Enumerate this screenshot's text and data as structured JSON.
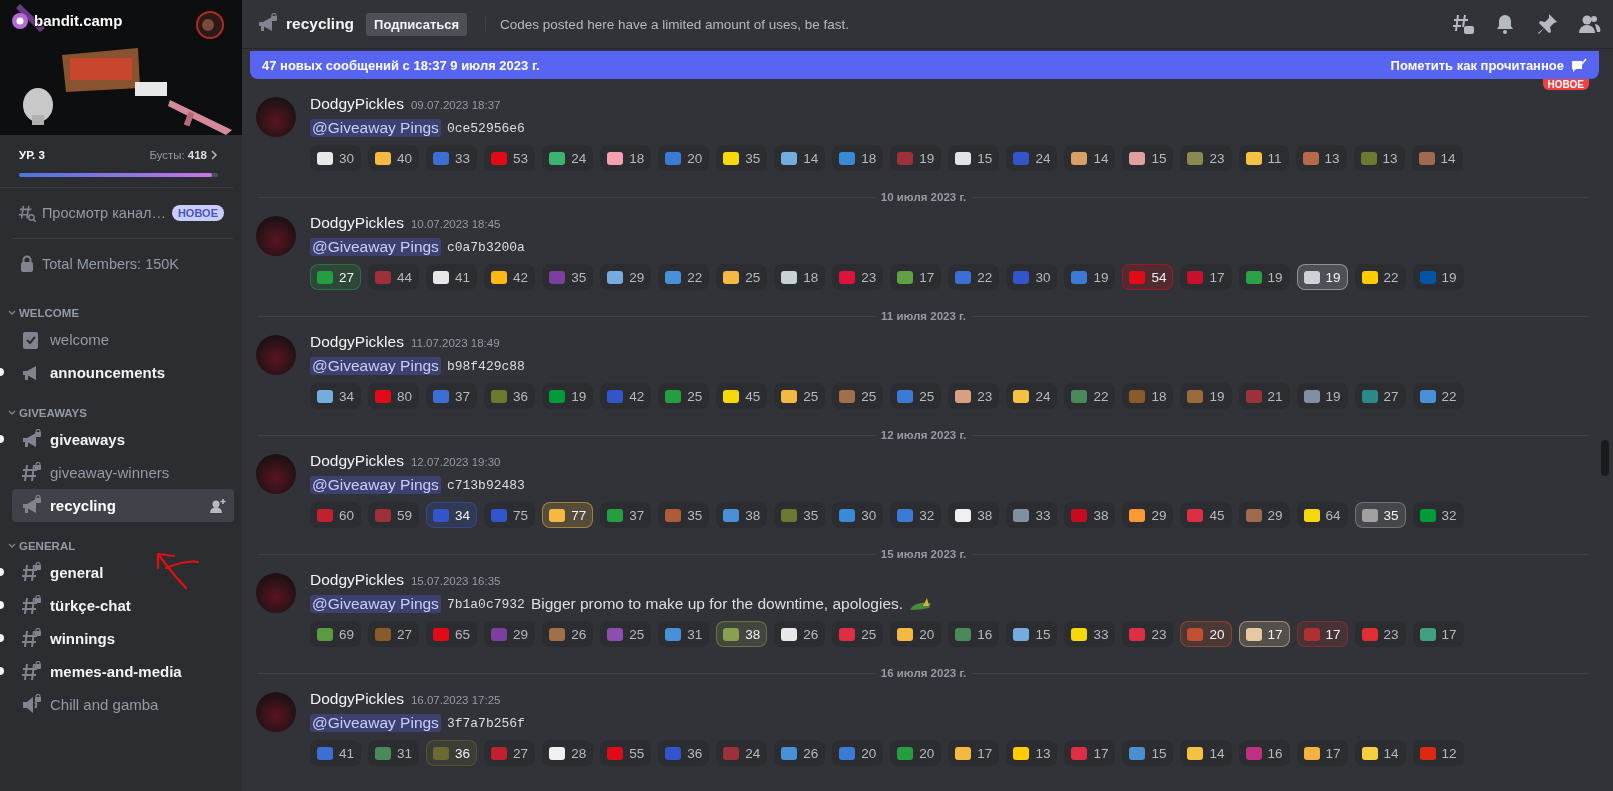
{
  "server": {
    "name": "bandit.camp"
  },
  "boost": {
    "level_label": "УР. 3",
    "boosts_label": "Бусты:",
    "boosts_count": "418",
    "level": 0.97
  },
  "browse": {
    "label": "Просмотр канал…",
    "badge": "НОВОЕ"
  },
  "members": {
    "label": "Total Members: 150K"
  },
  "categories": [
    {
      "name": "WELCOME",
      "expanded": true,
      "channels": [
        {
          "name": "welcome",
          "kind": "rules",
          "unread": false,
          "selected": false
        },
        {
          "name": "announcements",
          "kind": "announcement",
          "unread": true,
          "selected": false
        }
      ]
    },
    {
      "name": "GIVEAWAYS",
      "expanded": true,
      "channels": [
        {
          "name": "giveaways",
          "kind": "announcement-locked",
          "unread": true,
          "selected": false
        },
        {
          "name": "giveaway-winners",
          "kind": "text-locked",
          "unread": false,
          "selected": false
        },
        {
          "name": "recycling",
          "kind": "announcement-locked",
          "unread": false,
          "selected": true
        }
      ]
    },
    {
      "name": "GENERAL",
      "expanded": true,
      "channels": [
        {
          "name": "general",
          "kind": "text-locked",
          "unread": true,
          "selected": false
        },
        {
          "name": "türkçe-chat",
          "kind": "text-locked",
          "unread": true,
          "selected": false
        },
        {
          "name": "winnings",
          "kind": "text-locked",
          "unread": true,
          "selected": false
        },
        {
          "name": "memes-and-media",
          "kind": "text-locked",
          "unread": true,
          "selected": false
        },
        {
          "name": "Chill and gamba",
          "kind": "voice-locked",
          "unread": false,
          "selected": false
        }
      ]
    }
  ],
  "header": {
    "channel": "recycling",
    "follow_button": "Подписаться",
    "topic": "Codes posted here have a limited amount of uses, be fast."
  },
  "new_banner": {
    "text": "47 новых сообщений с 18:37 9 июля 2023 г.",
    "action": "Пометить как прочитанное"
  },
  "new_divider": {
    "badge": "НОВОЕ"
  },
  "messages": [
    {
      "author": "DodgyPickles",
      "timestamp": "09.07.2023 18:37",
      "mention": "@Giveaway Pings",
      "code": "0ce52956e6",
      "trailing_emoji": false,
      "reactions": [
        {
          "count": "30",
          "color": "#e8e8e8",
          "selected": false
        },
        {
          "count": "40",
          "color": "#f4b942",
          "selected": false
        },
        {
          "count": "33",
          "color": "#3b6fd6",
          "selected": false
        },
        {
          "count": "53",
          "color": "#e30a17",
          "selected": false
        },
        {
          "count": "24",
          "color": "#3cb371",
          "selected": false
        },
        {
          "count": "18",
          "color": "#f4a0b0",
          "selected": false
        },
        {
          "count": "20",
          "color": "#3a7bd5",
          "selected": false
        },
        {
          "count": "35",
          "color": "#f5d90a",
          "selected": false
        },
        {
          "count": "14",
          "color": "#74acdf",
          "selected": false
        },
        {
          "count": "18",
          "color": "#3a8ad8",
          "selected": false
        },
        {
          "count": "19",
          "color": "#9e3039",
          "selected": false
        },
        {
          "count": "15",
          "color": "#e0e4ea",
          "selected": false
        },
        {
          "count": "24",
          "color": "#3355cc",
          "selected": false
        },
        {
          "count": "14",
          "color": "#d9a066",
          "selected": false
        },
        {
          "count": "15",
          "color": "#e0a0a0",
          "selected": false
        },
        {
          "count": "23",
          "color": "#8a8a50",
          "selected": false
        },
        {
          "count": "11",
          "color": "#f4c242",
          "selected": false
        },
        {
          "count": "13",
          "color": "#b56a4a",
          "selected": false
        },
        {
          "count": "13",
          "color": "#6b7a30",
          "selected": false
        },
        {
          "count": "14",
          "color": "#a06a50",
          "selected": false
        }
      ]
    },
    {
      "divider": "10 июля 2023 г.",
      "author": "DodgyPickles",
      "timestamp": "10.07.2023 18:45",
      "mention": "@Giveaway Pings",
      "code": "c0a7b3200a",
      "trailing_emoji": false,
      "reactions": [
        {
          "count": "27",
          "color": "#239f40",
          "selected": true
        },
        {
          "count": "44",
          "color": "#9e3039",
          "selected": false
        },
        {
          "count": "41",
          "color": "#e8e8e8",
          "selected": false
        },
        {
          "count": "42",
          "color": "#fdb913",
          "selected": false
        },
        {
          "count": "35",
          "color": "#7b3fa0",
          "selected": false
        },
        {
          "count": "29",
          "color": "#74acdf",
          "selected": false
        },
        {
          "count": "22",
          "color": "#4891d9",
          "selected": false
        },
        {
          "count": "25",
          "color": "#f4b942",
          "selected": false
        },
        {
          "count": "18",
          "color": "#c8d0d8",
          "selected": false
        },
        {
          "count": "23",
          "color": "#dc143c",
          "selected": false
        },
        {
          "count": "17",
          "color": "#5fa040",
          "selected": false
        },
        {
          "count": "22",
          "color": "#3b6fd6",
          "selected": false
        },
        {
          "count": "30",
          "color": "#3355cc",
          "selected": false
        },
        {
          "count": "19",
          "color": "#3a7bd5",
          "selected": false
        },
        {
          "count": "54",
          "color": "#e30a17",
          "selected": true
        },
        {
          "count": "17",
          "color": "#c8102e",
          "selected": false
        },
        {
          "count": "19",
          "color": "#2aa048",
          "selected": false
        },
        {
          "count": "19",
          "color": "#d0d0d8",
          "selected": true
        },
        {
          "count": "22",
          "color": "#ffcc00",
          "selected": false
        },
        {
          "count": "19",
          "color": "#0055a4",
          "selected": false
        }
      ]
    },
    {
      "divider": "11 июля 2023 г.",
      "author": "DodgyPickles",
      "timestamp": "11.07.2023 18:49",
      "mention": "@Giveaway Pings",
      "code": "b98f429c88",
      "trailing_emoji": false,
      "reactions": [
        {
          "count": "34",
          "color": "#74acdf",
          "selected": false
        },
        {
          "count": "80",
          "color": "#e30a17",
          "selected": false
        },
        {
          "count": "37",
          "color": "#3b6fd6",
          "selected": false
        },
        {
          "count": "36",
          "color": "#6b7a30",
          "selected": false
        },
        {
          "count": "19",
          "color": "#009c3b",
          "selected": false
        },
        {
          "count": "42",
          "color": "#3355cc",
          "selected": false
        },
        {
          "count": "25",
          "color": "#239f40",
          "selected": false
        },
        {
          "count": "45",
          "color": "#f5d90a",
          "selected": false
        },
        {
          "count": "25",
          "color": "#f4b942",
          "selected": false
        },
        {
          "count": "25",
          "color": "#a0704a",
          "selected": false
        },
        {
          "count": "25",
          "color": "#3a7bd5",
          "selected": false
        },
        {
          "count": "23",
          "color": "#d9a080",
          "selected": false
        },
        {
          "count": "24",
          "color": "#f4c242",
          "selected": false
        },
        {
          "count": "22",
          "color": "#4a8a5a",
          "selected": false
        },
        {
          "count": "18",
          "color": "#8b5a2b",
          "selected": false
        },
        {
          "count": "19",
          "color": "#9b6a3b",
          "selected": false
        },
        {
          "count": "21",
          "color": "#9e3039",
          "selected": false
        },
        {
          "count": "19",
          "color": "#8090a0",
          "selected": false
        },
        {
          "count": "27",
          "color": "#2a8a8a",
          "selected": false
        },
        {
          "count": "22",
          "color": "#4891d9",
          "selected": false
        }
      ]
    },
    {
      "divider": "12 июля 2023 г.",
      "author": "DodgyPickles",
      "timestamp": "12.07.2023 19:30",
      "mention": "@Giveaway Pings",
      "code": "c713b92483",
      "trailing_emoji": false,
      "reactions": [
        {
          "count": "60",
          "color": "#c02030",
          "selected": false
        },
        {
          "count": "59",
          "color": "#9e3039",
          "selected": false
        },
        {
          "count": "34",
          "color": "#3355cc",
          "selected": true
        },
        {
          "count": "75",
          "color": "#3355cc",
          "selected": false
        },
        {
          "count": "77",
          "color": "#f4b942",
          "selected": true
        },
        {
          "count": "37",
          "color": "#239f40",
          "selected": false
        },
        {
          "count": "35",
          "color": "#b05a3a",
          "selected": false
        },
        {
          "count": "38",
          "color": "#4891d9",
          "selected": false
        },
        {
          "count": "35",
          "color": "#6b7a30",
          "selected": false
        },
        {
          "count": "30",
          "color": "#3a8ad8",
          "selected": false
        },
        {
          "count": "32",
          "color": "#3a7bd5",
          "selected": false
        },
        {
          "count": "38",
          "color": "#f0f0f0",
          "selected": false
        },
        {
          "count": "33",
          "color": "#8090a0",
          "selected": false
        },
        {
          "count": "38",
          "color": "#c60b1e",
          "selected": false
        },
        {
          "count": "29",
          "color": "#ff9933",
          "selected": false
        },
        {
          "count": "45",
          "color": "#dd2e44",
          "selected": false
        },
        {
          "count": "29",
          "color": "#a06a50",
          "selected": false
        },
        {
          "count": "64",
          "color": "#f5d90a",
          "selected": false
        },
        {
          "count": "35",
          "color": "#a0a0a0",
          "selected": true
        },
        {
          "count": "32",
          "color": "#009c3b",
          "selected": false
        }
      ]
    },
    {
      "divider": "15 июля 2023 г.",
      "author": "DodgyPickles",
      "timestamp": "15.07.2023 16:35",
      "mention": "@Giveaway Pings",
      "code": "7b1a0c7932",
      "text": "Bigger promo to make up for the downtime, apologies.",
      "trailing_emoji": true,
      "reactions": [
        {
          "count": "69",
          "color": "#5a9a40",
          "selected": false
        },
        {
          "count": "27",
          "color": "#8b5a2b",
          "selected": false
        },
        {
          "count": "65",
          "color": "#e30a17",
          "selected": false
        },
        {
          "count": "29",
          "color": "#7b3fa0",
          "selected": false
        },
        {
          "count": "26",
          "color": "#a0704a",
          "selected": false
        },
        {
          "count": "25",
          "color": "#8b4fb0",
          "selected": false
        },
        {
          "count": "31",
          "color": "#4891d9",
          "selected": false
        },
        {
          "count": "38",
          "color": "#8aa050",
          "selected": true
        },
        {
          "count": "26",
          "color": "#e8e8e8",
          "selected": false
        },
        {
          "count": "25",
          "color": "#dd2e44",
          "selected": false
        },
        {
          "count": "20",
          "color": "#f4b942",
          "selected": false
        },
        {
          "count": "16",
          "color": "#4a8a5a",
          "selected": false
        },
        {
          "count": "15",
          "color": "#74acdf",
          "selected": false
        },
        {
          "count": "33",
          "color": "#f5d90a",
          "selected": false
        },
        {
          "count": "23",
          "color": "#dd2e44",
          "selected": false
        },
        {
          "count": "20",
          "color": "#c05030",
          "selected": true
        },
        {
          "count": "17",
          "color": "#e8c8a0",
          "selected": true
        },
        {
          "count": "17",
          "color": "#b03030",
          "selected": true
        },
        {
          "count": "23",
          "color": "#e02e34",
          "selected": false
        },
        {
          "count": "17",
          "color": "#40a080",
          "selected": false
        }
      ]
    },
    {
      "divider": "16 июля 2023 г.",
      "author": "DodgyPickles",
      "timestamp": "16.07.2023 17:25",
      "mention": "@Giveaway Pings",
      "code": "3f7a7b256f",
      "trailing_emoji": false,
      "reactions": [
        {
          "count": "41",
          "color": "#3b6fd6",
          "selected": false
        },
        {
          "count": "31",
          "color": "#4a8a5a",
          "selected": false
        },
        {
          "count": "36",
          "color": "#6b6a30",
          "selected": true
        },
        {
          "count": "27",
          "color": "#c02030",
          "selected": false
        },
        {
          "count": "28",
          "color": "#f0f0f0",
          "selected": false
        },
        {
          "count": "55",
          "color": "#e30a17",
          "selected": false
        },
        {
          "count": "36",
          "color": "#3355cc",
          "selected": false
        },
        {
          "count": "24",
          "color": "#9e3039",
          "selected": false
        },
        {
          "count": "26",
          "color": "#4891d9",
          "selected": false
        },
        {
          "count": "20",
          "color": "#3a7bd5",
          "selected": false
        },
        {
          "count": "20",
          "color": "#239f40",
          "selected": false
        },
        {
          "count": "17",
          "color": "#f4b942",
          "selected": false
        },
        {
          "count": "13",
          "color": "#ffcc00",
          "selected": false
        },
        {
          "count": "17",
          "color": "#dd2e44",
          "selected": false
        },
        {
          "count": "15",
          "color": "#4a90d0",
          "selected": false
        },
        {
          "count": "14",
          "color": "#f4c242",
          "selected": false
        },
        {
          "count": "16",
          "color": "#c03080",
          "selected": false
        },
        {
          "count": "17",
          "color": "#f4b040",
          "selected": false
        },
        {
          "count": "14",
          "color": "#f4d040",
          "selected": false
        },
        {
          "count": "12",
          "color": "#de2910",
          "selected": false
        }
      ]
    }
  ]
}
